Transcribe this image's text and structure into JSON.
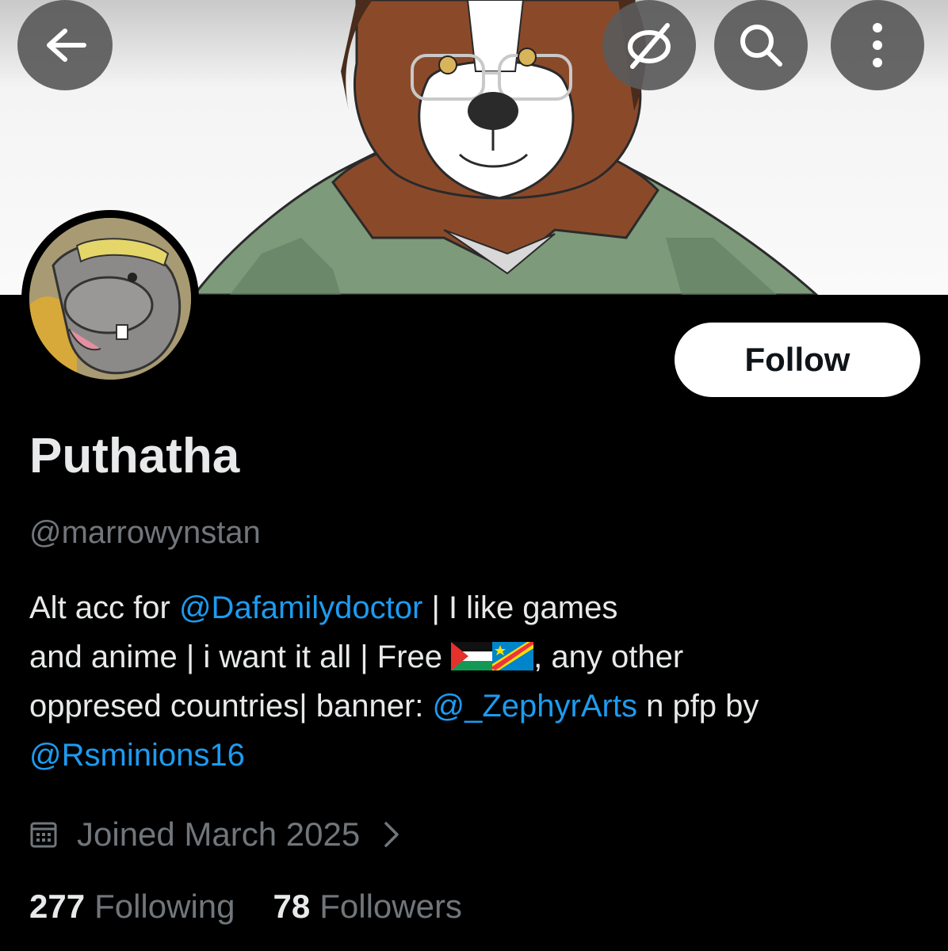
{
  "header": {
    "back_icon": "arrow-left-icon",
    "block_icon": "eye-off-icon",
    "search_icon": "search-icon",
    "more_icon": "more-vertical-icon"
  },
  "profile": {
    "display_name": "Puthatha",
    "handle": "@marrowynstan",
    "follow_label": "Follow",
    "bio": {
      "line1_prefix": "Alt acc for ",
      "line1_mention": "@Dafamilydoctor",
      "line1_suffix": " | I like games",
      "line2_prefix": "and anime | i want it all |  Free ",
      "line2_flags": [
        "palestine-flag",
        "dr-congo-flag"
      ],
      "line2_suffix": ", any other",
      "line3_prefix": "oppresed countries| banner: ",
      "line3_mention": "@_ZephyrArts",
      "line3_suffix": " n pfp by",
      "line4_mention": "@Rsminions16"
    },
    "joined": "Joined March 2025",
    "following_count": "277",
    "following_label": "Following",
    "followers_count": "78",
    "followers_label": "Followers"
  },
  "colors": {
    "background": "#000000",
    "text": "#e7e9ea",
    "muted": "#71767b",
    "link": "#1d9bf0",
    "follow_button_bg": "#ffffff"
  }
}
